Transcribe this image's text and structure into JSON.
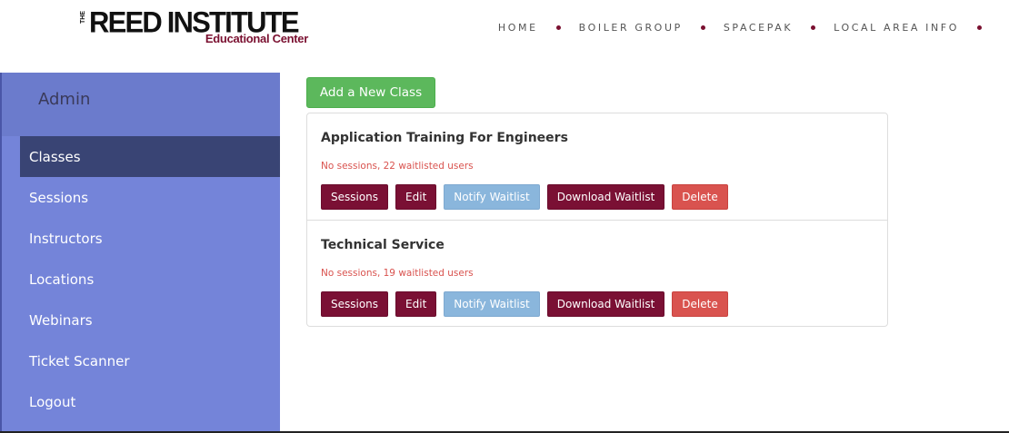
{
  "header": {
    "logo_the": "THE",
    "logo_main": "REED INSTITUTE",
    "logo_sub": "Educational Center",
    "nav": [
      {
        "label": "HOME"
      },
      {
        "label": "BOILER GROUP"
      },
      {
        "label": "SPACEPAK"
      },
      {
        "label": "LOCAL AREA INFO"
      }
    ]
  },
  "sidebar": {
    "title": "Admin",
    "items": [
      {
        "label": "Classes",
        "active": true
      },
      {
        "label": "Sessions"
      },
      {
        "label": "Instructors"
      },
      {
        "label": "Locations"
      },
      {
        "label": "Webinars"
      },
      {
        "label": "Ticket Scanner"
      },
      {
        "label": "Logout"
      }
    ]
  },
  "content": {
    "add_button": "Add a New Class",
    "classes": [
      {
        "title": "Application Training For Engineers",
        "status": "No sessions, 22 waitlisted users",
        "buttons": {
          "sessions": "Sessions",
          "edit": "Edit",
          "notify": "Notify Waitlist",
          "download": "Download Waitlist",
          "delete": "Delete"
        }
      },
      {
        "title": "Technical Service",
        "status": "No sessions, 19 waitlisted users",
        "buttons": {
          "sessions": "Sessions",
          "edit": "Edit",
          "notify": "Notify Waitlist",
          "download": "Download Waitlist",
          "delete": "Delete"
        }
      }
    ]
  },
  "colors": {
    "brand_maroon": "#7a1034",
    "sidebar_bg": "#7484d9",
    "sidebar_active": "#394474",
    "success": "#5cb85c",
    "info_light": "#8ab6dc",
    "danger": "#d9534f"
  }
}
